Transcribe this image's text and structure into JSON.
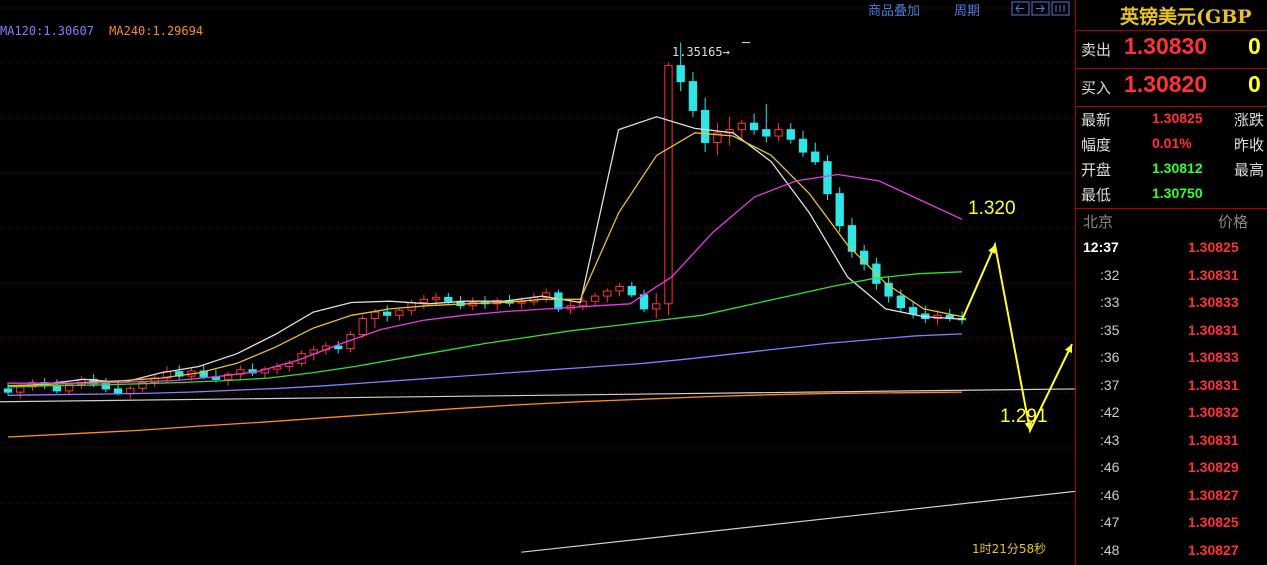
{
  "toolbar": {
    "overlay_label": "商品叠加",
    "period_label": "周期"
  },
  "ma_legend": [
    {
      "label": "MA120:1.30607",
      "color": "#7f7fff"
    },
    {
      "label": "MA240:1.29694",
      "color": "#ff8c1a"
    }
  ],
  "annotations": {
    "peak": "1.35165→",
    "up_target": "1.320",
    "down_target": "1.291"
  },
  "timer": "1时21分58秒",
  "colors": {
    "up": "#ff3333",
    "down": "#2ee6e6",
    "grid": "#8b0000",
    "arrow": "#ffff33"
  },
  "panel": {
    "title": "英镑美元(GBP",
    "sell": {
      "label": "卖出",
      "price": "1.30830",
      "volume": "0"
    },
    "buy": {
      "label": "买入",
      "price": "1.30820",
      "volume": "0"
    },
    "stats": [
      {
        "label": "最新",
        "value": "1.30825",
        "value_color": "#ff3333",
        "label2": "涨跌"
      },
      {
        "label": "幅度",
        "value": "0.01%",
        "value_color": "#ff3333",
        "label2": "昨收"
      },
      {
        "label": "开盘",
        "value": "1.30812",
        "value_color": "#33ff33",
        "label2": "最高"
      },
      {
        "label": "最低",
        "value": "1.30750",
        "value_color": "#33ff33",
        "label2": ""
      }
    ],
    "tick_header": {
      "time": "北京",
      "price": "价格"
    },
    "ticks": [
      {
        "time": "12:37",
        "price": "1.30825"
      },
      {
        "time": ":32",
        "price": "1.30831"
      },
      {
        "time": ":33",
        "price": "1.30833"
      },
      {
        "time": ":35",
        "price": "1.30831"
      },
      {
        "time": ":36",
        "price": "1.30833"
      },
      {
        "time": ":37",
        "price": "1.30831"
      },
      {
        "time": ":42",
        "price": "1.30832"
      },
      {
        "time": ":43",
        "price": "1.30831"
      },
      {
        "time": ":46",
        "price": "1.30829"
      },
      {
        "time": ":46",
        "price": "1.30827"
      },
      {
        "time": ":47",
        "price": "1.30825"
      },
      {
        "time": ":48",
        "price": "1.30827"
      }
    ]
  },
  "chart_data": {
    "type": "candlestick",
    "ylim": [
      1.27,
      1.357
    ],
    "grid": true,
    "candles": [
      [
        1.2975,
        1.2985,
        1.2965,
        1.297
      ],
      [
        1.297,
        1.2982,
        1.296,
        1.2978
      ],
      [
        1.2978,
        1.299,
        1.2972,
        1.2985
      ],
      [
        1.2985,
        1.2992,
        1.2975,
        1.298
      ],
      [
        1.298,
        1.299,
        1.2968,
        1.2972
      ],
      [
        1.2972,
        1.2985,
        1.2965,
        1.2982
      ],
      [
        1.2982,
        1.2995,
        1.2975,
        1.299
      ],
      [
        1.299,
        1.2998,
        1.2978,
        1.2983
      ],
      [
        1.2983,
        1.2992,
        1.297,
        1.2975
      ],
      [
        1.2975,
        1.2986,
        1.2965,
        1.2968
      ],
      [
        1.2968,
        1.298,
        1.296,
        1.2976
      ],
      [
        1.2976,
        1.299,
        1.297,
        1.2985
      ],
      [
        1.2985,
        1.2998,
        1.2978,
        1.2992
      ],
      [
        1.2992,
        1.301,
        1.2985,
        1.3002
      ],
      [
        1.3002,
        1.3012,
        1.299,
        1.2995
      ],
      [
        1.2995,
        1.3008,
        1.2988,
        1.3003
      ],
      [
        1.3003,
        1.3012,
        1.299,
        1.2994
      ],
      [
        1.2994,
        1.3005,
        1.2985,
        1.299
      ],
      [
        1.299,
        1.3002,
        1.298,
        1.2998
      ],
      [
        1.2998,
        1.3012,
        1.299,
        1.3005
      ],
      [
        1.3005,
        1.3015,
        1.2995,
        1.3
      ],
      [
        1.3,
        1.301,
        1.2992,
        1.3006
      ],
      [
        1.3006,
        1.3016,
        1.2998,
        1.301
      ],
      [
        1.301,
        1.302,
        1.3002,
        1.3015
      ],
      [
        1.3015,
        1.3035,
        1.301,
        1.303
      ],
      [
        1.303,
        1.3042,
        1.302,
        1.3036
      ],
      [
        1.3036,
        1.3048,
        1.3028,
        1.3042
      ],
      [
        1.3042,
        1.305,
        1.303,
        1.3038
      ],
      [
        1.3038,
        1.3065,
        1.3032,
        1.306
      ],
      [
        1.306,
        1.309,
        1.3055,
        1.3085
      ],
      [
        1.3085,
        1.31,
        1.307,
        1.3095
      ],
      [
        1.3095,
        1.3105,
        1.308,
        1.309
      ],
      [
        1.309,
        1.3102,
        1.3082,
        1.3098
      ],
      [
        1.3098,
        1.3115,
        1.309,
        1.311
      ],
      [
        1.311,
        1.3122,
        1.31,
        1.3115
      ],
      [
        1.3115,
        1.3125,
        1.3105,
        1.3118
      ],
      [
        1.3118,
        1.3125,
        1.3108,
        1.3112
      ],
      [
        1.3112,
        1.312,
        1.31,
        1.3105
      ],
      [
        1.3105,
        1.3118,
        1.3098,
        1.311
      ],
      [
        1.311,
        1.312,
        1.31,
        1.3108
      ],
      [
        1.3108,
        1.3118,
        1.3098,
        1.3113
      ],
      [
        1.3113,
        1.3122,
        1.3104,
        1.3109
      ],
      [
        1.3109,
        1.3118,
        1.31,
        1.3111
      ],
      [
        1.3111,
        1.3125,
        1.3105,
        1.3118
      ],
      [
        1.3118,
        1.3132,
        1.311,
        1.3125
      ],
      [
        1.3125,
        1.313,
        1.3095,
        1.31
      ],
      [
        1.31,
        1.3112,
        1.3092,
        1.3105
      ],
      [
        1.3105,
        1.3118,
        1.3098,
        1.3112
      ],
      [
        1.3112,
        1.3125,
        1.3105,
        1.312
      ],
      [
        1.312,
        1.3132,
        1.311,
        1.3128
      ],
      [
        1.3128,
        1.314,
        1.312,
        1.3135
      ],
      [
        1.3135,
        1.3142,
        1.3118,
        1.3122
      ],
      [
        1.3122,
        1.313,
        1.3095,
        1.31
      ],
      [
        1.31,
        1.3125,
        1.3085,
        1.3108
      ],
      [
        1.3108,
        1.3485,
        1.309,
        1.348
      ],
      [
        1.348,
        1.3516,
        1.344,
        1.3455
      ],
      [
        1.3455,
        1.347,
        1.34,
        1.341
      ],
      [
        1.341,
        1.343,
        1.3345,
        1.336
      ],
      [
        1.336,
        1.339,
        1.334,
        1.3375
      ],
      [
        1.3375,
        1.34,
        1.3355,
        1.338
      ],
      [
        1.338,
        1.3395,
        1.3365,
        1.339
      ],
      [
        1.339,
        1.3405,
        1.3372,
        1.338
      ],
      [
        1.338,
        1.342,
        1.336,
        1.337
      ],
      [
        1.337,
        1.339,
        1.3362,
        1.338
      ],
      [
        1.338,
        1.339,
        1.3358,
        1.3365
      ],
      [
        1.3365,
        1.3378,
        1.3338,
        1.3345
      ],
      [
        1.3345,
        1.336,
        1.3325,
        1.333
      ],
      [
        1.333,
        1.334,
        1.327,
        1.328
      ],
      [
        1.328,
        1.329,
        1.322,
        1.323
      ],
      [
        1.323,
        1.3242,
        1.318,
        1.319
      ],
      [
        1.319,
        1.32,
        1.316,
        1.317
      ],
      [
        1.317,
        1.318,
        1.313,
        1.314
      ],
      [
        1.314,
        1.315,
        1.311,
        1.312
      ],
      [
        1.312,
        1.313,
        1.3095,
        1.3102
      ],
      [
        1.3102,
        1.3112,
        1.3085,
        1.3092
      ],
      [
        1.3092,
        1.3105,
        1.3078,
        1.3085
      ],
      [
        1.3085,
        1.3098,
        1.3075,
        1.309
      ],
      [
        1.309,
        1.31,
        1.308,
        1.3085
      ],
      [
        1.3085,
        1.3096,
        1.3076,
        1.3083
      ]
    ],
    "ma_lines": [
      {
        "name": "MA5",
        "color": "#dddddd",
        "values": [
          1.2978,
          1.2983,
          1.299,
          1.2985,
          1.3,
          1.301,
          1.303,
          1.306,
          1.3095,
          1.311,
          1.3112,
          1.3108,
          1.3112,
          1.3112,
          1.312,
          1.311,
          1.338,
          1.34,
          1.3382,
          1.3375,
          1.333,
          1.325,
          1.315,
          1.31,
          1.3088,
          1.3084
        ]
      },
      {
        "name": "MA10",
        "color": "#e6c229",
        "values": [
          1.298,
          1.2982,
          1.2985,
          1.2988,
          1.2992,
          1.3,
          1.3015,
          1.304,
          1.307,
          1.309,
          1.31,
          1.3105,
          1.3108,
          1.311,
          1.3115,
          1.3115,
          1.325,
          1.334,
          1.3375,
          1.337,
          1.334,
          1.328,
          1.32,
          1.314,
          1.31,
          1.3088
        ]
      },
      {
        "name": "MA20",
        "color": "#e63ce6",
        "values": [
          1.2984,
          1.2984,
          1.2984,
          1.2986,
          1.2988,
          1.2994,
          1.3002,
          1.302,
          1.3045,
          1.3068,
          1.3082,
          1.309,
          1.3096,
          1.31,
          1.3104,
          1.3108,
          1.315,
          1.322,
          1.3275,
          1.33,
          1.331,
          1.33,
          1.327,
          1.324
        ]
      },
      {
        "name": "MA60",
        "color": "#33dd33",
        "values": [
          1.2978,
          1.298,
          1.2981,
          1.2983,
          1.2985,
          1.2988,
          1.2992,
          1.3,
          1.301,
          1.3022,
          1.3034,
          1.3046,
          1.3056,
          1.3066,
          1.3074,
          1.3082,
          1.309,
          1.3105,
          1.312,
          1.3135,
          1.3148,
          1.3155,
          1.3158
        ]
      },
      {
        "name": "MA120",
        "color": "#7f7fff",
        "values": [
          1.2965,
          1.2966,
          1.2967,
          1.2968,
          1.297,
          1.2973,
          1.2976,
          1.298,
          1.2985,
          1.299,
          1.2995,
          1.3,
          1.3005,
          1.301,
          1.3015,
          1.3022,
          1.303,
          1.3038,
          1.3046,
          1.3052,
          1.3058,
          1.3061
        ]
      },
      {
        "name": "MA240",
        "color": "#ff8c1a",
        "values": [
          1.29,
          1.2905,
          1.291,
          1.2917,
          1.2923,
          1.293,
          1.2937,
          1.2944,
          1.295,
          1.2955,
          1.2959,
          1.2963,
          1.2966,
          1.2968,
          1.2969,
          1.297
        ]
      }
    ],
    "trendlines": [
      {
        "from": [
          1.2955,
          0
        ],
        "to": [
          1.2975,
          1.0
        ]
      },
      {
        "from": [
          1.272,
          0.485
        ],
        "to": [
          1.2815,
          1.0
        ]
      }
    ],
    "projection": [
      1.3083,
      1.32,
      1.291,
      1.3045
    ]
  }
}
